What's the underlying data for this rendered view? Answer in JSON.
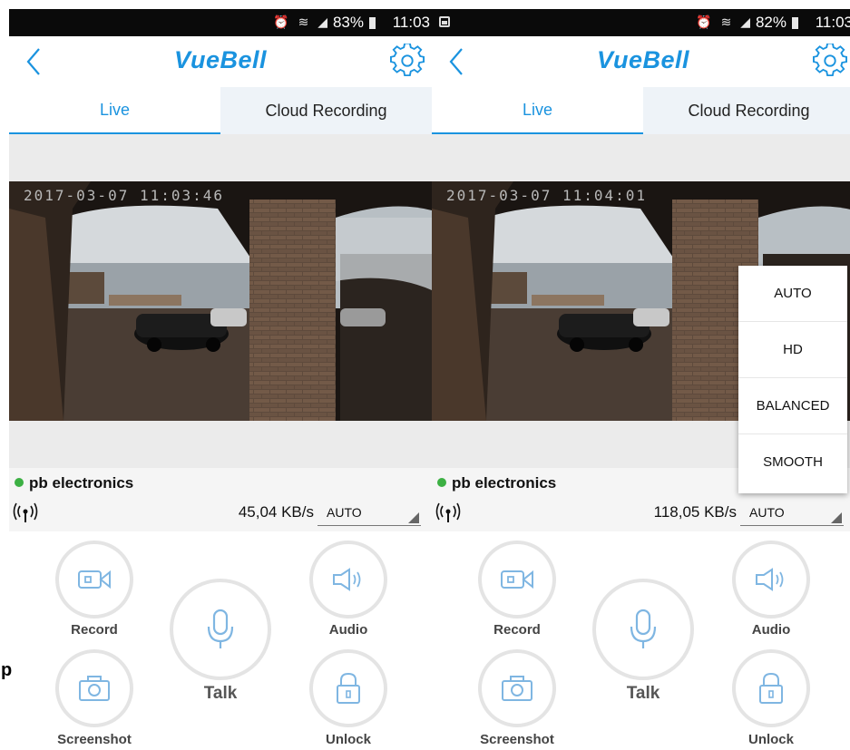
{
  "screens": [
    {
      "status": {
        "battery": "83%",
        "time": "11:03"
      },
      "header": {
        "brand": "VueBell"
      },
      "tabs": [
        {
          "label": "Live"
        },
        {
          "label": "Cloud Recording"
        }
      ],
      "video": {
        "timestamp": "2017-03-07  11:03:46"
      },
      "device": {
        "name": "pb electronics",
        "speed": "45,04 KB/s",
        "quality": "AUTO"
      },
      "controls": {
        "record": "Record",
        "audio": "Audio",
        "talk": "Talk",
        "screenshot": "Screenshot",
        "unlock": "Unlock"
      }
    },
    {
      "status": {
        "battery": "82%",
        "time": "11:03"
      },
      "header": {
        "brand": "VueBell"
      },
      "tabs": [
        {
          "label": "Live"
        },
        {
          "label": "Cloud Recording"
        }
      ],
      "video": {
        "timestamp": "2017-03-07  11:04:01"
      },
      "device": {
        "name": "pb electronics",
        "speed": "118,05 KB/s",
        "quality": "AUTO"
      },
      "controls": {
        "record": "Record",
        "audio": "Audio",
        "talk": "Talk",
        "screenshot": "Screenshot",
        "unlock": "Unlock"
      },
      "quality_menu": [
        "AUTO",
        "HD",
        "BALANCED",
        "SMOOTH"
      ]
    }
  ],
  "edge_glyph": "p",
  "colors": {
    "accent": "#1a93df",
    "online": "#3cb043",
    "tab_inactive_bg": "#eef3f8"
  }
}
